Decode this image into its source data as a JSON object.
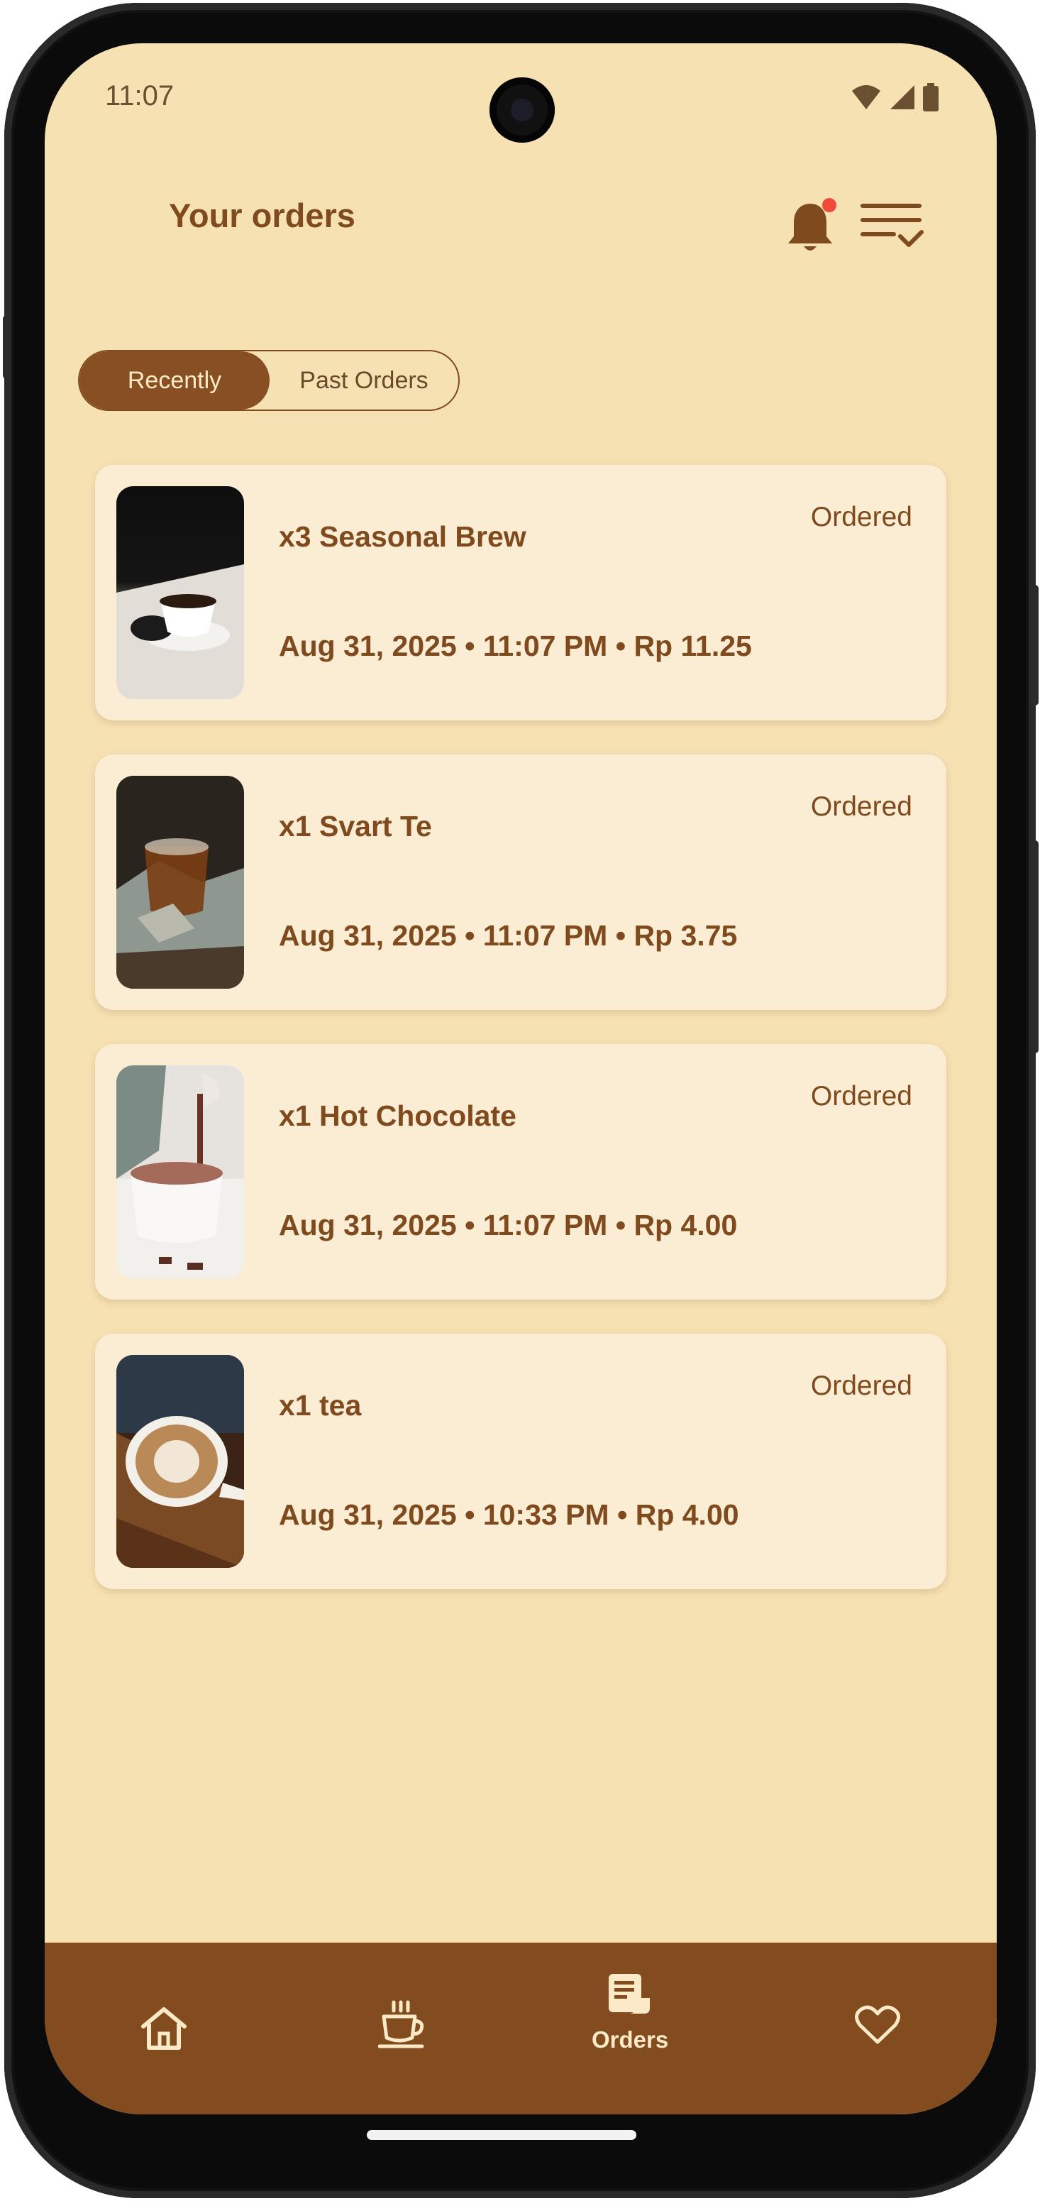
{
  "status_bar": {
    "time": "11:07"
  },
  "header": {
    "title": "Your orders",
    "bell_icon": "notification-bell-icon",
    "filter_icon": "sort-filter-icon"
  },
  "segment": {
    "recent_label": "Recently",
    "past_label": "Past Orders",
    "active": "Recently"
  },
  "orders": [
    {
      "name": "x3 Seasonal Brew",
      "meta": "Aug 31, 2025 • 11:07 PM • Rp 11.25",
      "status": "Ordered",
      "image": "coffee-cup-photo"
    },
    {
      "name": "x1 Svart Te",
      "meta": "Aug 31, 2025 • 11:07 PM • Rp 3.75",
      "status": "Ordered",
      "image": "tea-glass-photo"
    },
    {
      "name": "x1 Hot Chocolate",
      "meta": "Aug 31, 2025 • 11:07 PM • Rp 4.00",
      "status": "Ordered",
      "image": "hot-chocolate-photo"
    },
    {
      "name": "x1 tea",
      "meta": "Aug 31, 2025 • 10:33 PM • Rp 4.00",
      "status": "Ordered",
      "image": "latte-art-photo"
    }
  ],
  "bottom_nav": {
    "items": [
      {
        "icon": "home-icon",
        "label": ""
      },
      {
        "icon": "coffee-cup-icon",
        "label": ""
      },
      {
        "icon": "orders-receipt-icon",
        "label": "Orders"
      },
      {
        "icon": "heart-icon",
        "label": ""
      }
    ],
    "active": "Orders"
  },
  "colors": {
    "background": "#f6e1b3",
    "card": "#faedd3",
    "primary": "#834c1e",
    "accent_text": "#7f4a1d",
    "notification_dot": "#f04a3c"
  }
}
